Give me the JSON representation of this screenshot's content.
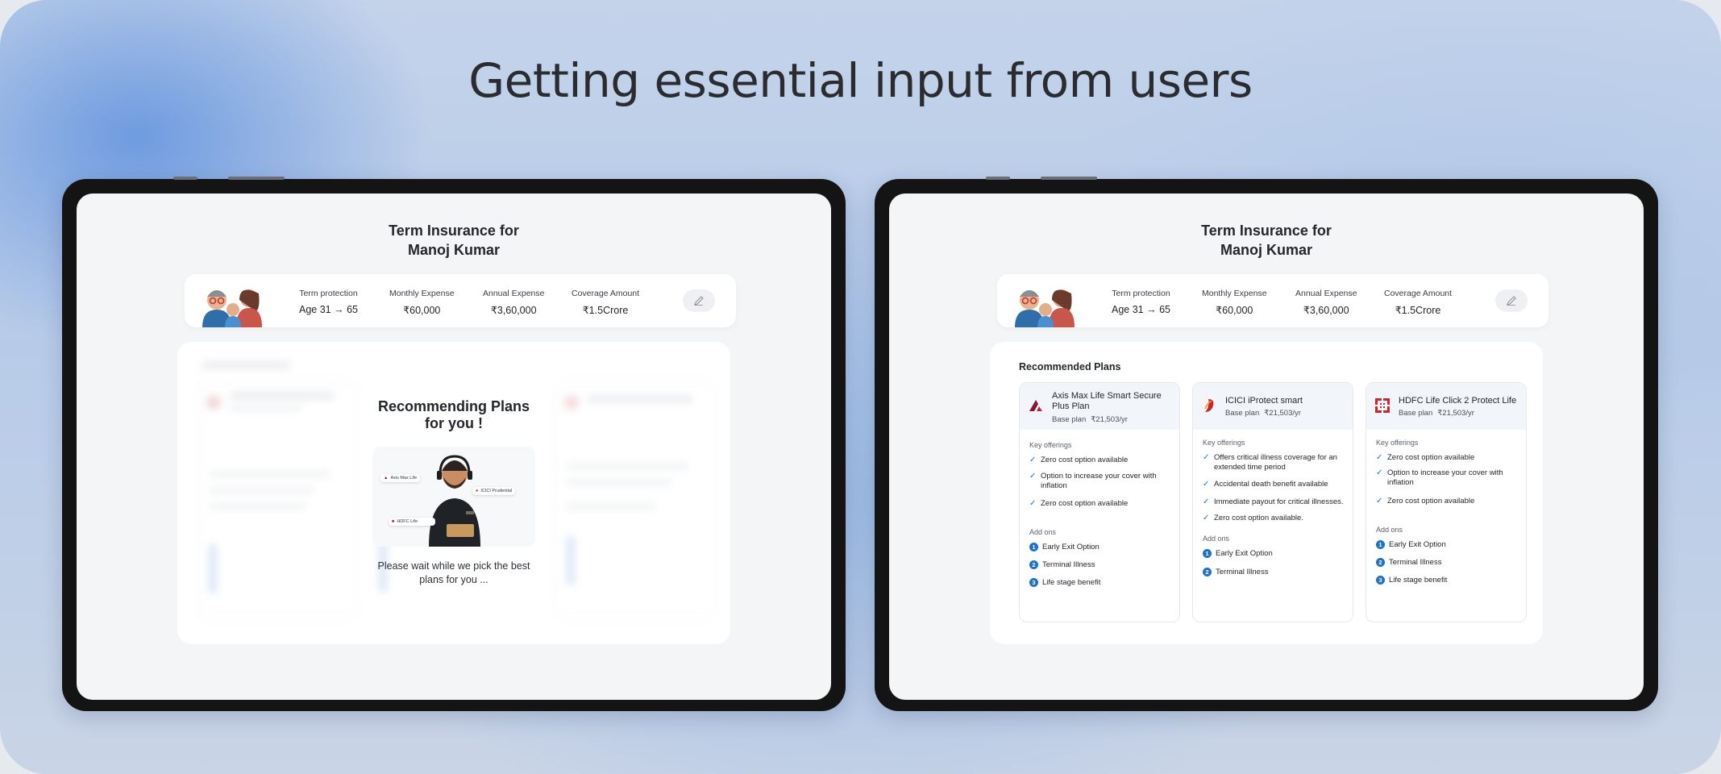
{
  "headline": "Getting essential input from users",
  "colors": {
    "accent": "#1a73c9",
    "axis_red": "#8b1538",
    "icici_red": "#d2232a",
    "hdfc_red": "#d3222a"
  },
  "page": {
    "title_line1": "Term Insurance for",
    "title_line2": "Manoj Kumar"
  },
  "summary": {
    "term_label": "Term protection",
    "term_value": "Age 31 → 65",
    "monthly_label": "Monthly Expense",
    "monthly_value": "₹60,000",
    "annual_label": "Annual Expense",
    "annual_value": "₹3,60,000",
    "coverage_label": "Coverage Amount",
    "coverage_value": "₹1.5Crore",
    "edit_icon": "pencil-icon"
  },
  "loader": {
    "title_line1": "Recommending Plans",
    "title_line2": "for you !",
    "tag_axis": "Axis Max Life",
    "tag_icici": "ICICI Prudential",
    "tag_hdfc": "HDFC Life",
    "message": "Please wait while we pick the best plans for you ..."
  },
  "recommended": {
    "title": "Recommended Plans",
    "key_offerings_label": "Key offerings",
    "addons_label": "Add ons",
    "base_plan_label": "Base plan",
    "plans": [
      {
        "name": "Axis Max Life Smart Secure Plus Plan",
        "price": "₹21,503/yr",
        "offerings": [
          "Zero cost option available",
          "Option to increase your cover with inflation",
          "Zero cost option available"
        ],
        "addons": [
          "Early Exit Option",
          "Terminal Illness",
          "Life stage benefit"
        ]
      },
      {
        "name": "ICICI iProtect smart",
        "price": "₹21,503/yr",
        "offerings": [
          "Offers critical illness coverage for an extended time period",
          "Accidental death benefit available",
          "Immediate payout for critical illnesses.",
          "Zero cost option available."
        ],
        "addons": [
          "Early Exit Option",
          "Terminal Illness"
        ]
      },
      {
        "name": "HDFC Life Click 2 Protect Life",
        "price": "₹21,503/yr",
        "offerings": [
          "Zero cost option available",
          "Option to increase your cover with inflation",
          "Zero cost option available"
        ],
        "addons": [
          "Early Exit Option",
          "Terminal Illness",
          "Life stage benefit"
        ]
      }
    ]
  }
}
